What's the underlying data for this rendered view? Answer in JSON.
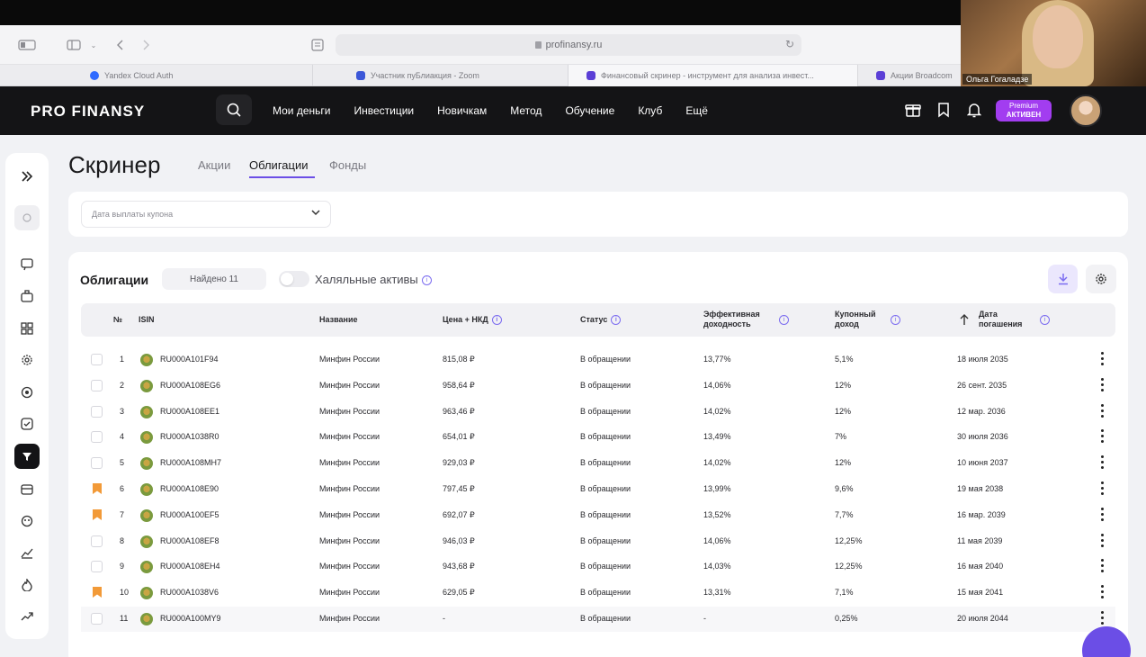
{
  "browser": {
    "url": "profinansy.ru",
    "tabs": [
      {
        "label": "Yandex Cloud Auth",
        "color": "#2f6bff"
      },
      {
        "label": "Участник пуБлиакция - Zoom",
        "color": "#3c57d8"
      },
      {
        "label": "Финансовый скринер - инструмент для анализа инвест...",
        "color": "#5b3fd6"
      },
      {
        "label": "Акции Broadcom",
        "color": "#5b3fd6"
      }
    ]
  },
  "webcam": {
    "name": "Ольга Гогаладзе"
  },
  "header": {
    "logo": "PRO FINANSY",
    "nav": [
      "Мои деньги",
      "Инвестиции",
      "Новичкам",
      "Метод",
      "Обучение",
      "Клуб",
      "Ещё"
    ],
    "premium_line1": "Premium",
    "premium_line2": "АКТИВЕН"
  },
  "page": {
    "title": "Скринер",
    "tabs": [
      "Акции",
      "Облигации",
      "Фонды"
    ],
    "active_tab": "Облигации",
    "filter": {
      "placeholder": "Дата выплаты купона"
    }
  },
  "table": {
    "title": "Облигации",
    "found": "Найдено 11",
    "halal_label": "Халяльные активы",
    "columns": {
      "num": "№",
      "isin": "ISIN",
      "name": "Название",
      "price": "Цена + НКД",
      "status": "Статус",
      "yield_1": "Эффективная",
      "yield_2": "доходность",
      "coupon_1": "Купонный",
      "coupon_2": "доход",
      "date_1": "Дата",
      "date_2": "погашения"
    },
    "rows": [
      {
        "n": "1",
        "isin": "RU000A101F94",
        "name": "Минфин России",
        "price": "815,08 ₽",
        "status": "В обращении",
        "yield": "13,77%",
        "coupon": "5,1%",
        "date": "18 июля 2035",
        "bookmarked": false
      },
      {
        "n": "2",
        "isin": "RU000A108EG6",
        "name": "Минфин России",
        "price": "958,64 ₽",
        "status": "В обращении",
        "yield": "14,06%",
        "coupon": "12%",
        "date": "26 сент. 2035",
        "bookmarked": false
      },
      {
        "n": "3",
        "isin": "RU000A108EE1",
        "name": "Минфин России",
        "price": "963,46 ₽",
        "status": "В обращении",
        "yield": "14,02%",
        "coupon": "12%",
        "date": "12 мар. 2036",
        "bookmarked": false
      },
      {
        "n": "4",
        "isin": "RU000A1038R0",
        "name": "Минфин России",
        "price": "654,01 ₽",
        "status": "В обращении",
        "yield": "13,49%",
        "coupon": "7%",
        "date": "30 июля 2036",
        "bookmarked": false
      },
      {
        "n": "5",
        "isin": "RU000A108MH7",
        "name": "Минфин России",
        "price": "929,03 ₽",
        "status": "В обращении",
        "yield": "14,02%",
        "coupon": "12%",
        "date": "10 июня 2037",
        "bookmarked": false
      },
      {
        "n": "6",
        "isin": "RU000A108E90",
        "name": "Минфин России",
        "price": "797,45 ₽",
        "status": "В обращении",
        "yield": "13,99%",
        "coupon": "9,6%",
        "date": "19 мая 2038",
        "bookmarked": true
      },
      {
        "n": "7",
        "isin": "RU000A100EF5",
        "name": "Минфин России",
        "price": "692,07 ₽",
        "status": "В обращении",
        "yield": "13,52%",
        "coupon": "7,7%",
        "date": "16 мар. 2039",
        "bookmarked": true
      },
      {
        "n": "8",
        "isin": "RU000A108EF8",
        "name": "Минфин России",
        "price": "946,03 ₽",
        "status": "В обращении",
        "yield": "14,06%",
        "coupon": "12,25%",
        "date": "11 мая 2039",
        "bookmarked": false
      },
      {
        "n": "9",
        "isin": "RU000A108EH4",
        "name": "Минфин России",
        "price": "943,68 ₽",
        "status": "В обращении",
        "yield": "14,03%",
        "coupon": "12,25%",
        "date": "16 мая 2040",
        "bookmarked": false
      },
      {
        "n": "10",
        "isin": "RU000A1038V6",
        "name": "Минфин России",
        "price": "629,05 ₽",
        "status": "В обращении",
        "yield": "13,31%",
        "coupon": "7,1%",
        "date": "15 мая 2041",
        "bookmarked": true
      },
      {
        "n": "11",
        "isin": "RU000A100MY9",
        "name": "Минфин России",
        "price": "-",
        "status": "В обращении",
        "yield": "-",
        "coupon": "0,25%",
        "date": "20 июля 2044",
        "bookmarked": false
      }
    ]
  },
  "colors": {
    "accent": "#6b4ee6",
    "premium": "#a23df0",
    "bookmark": "#f29a38",
    "header_bg": "#141416"
  }
}
